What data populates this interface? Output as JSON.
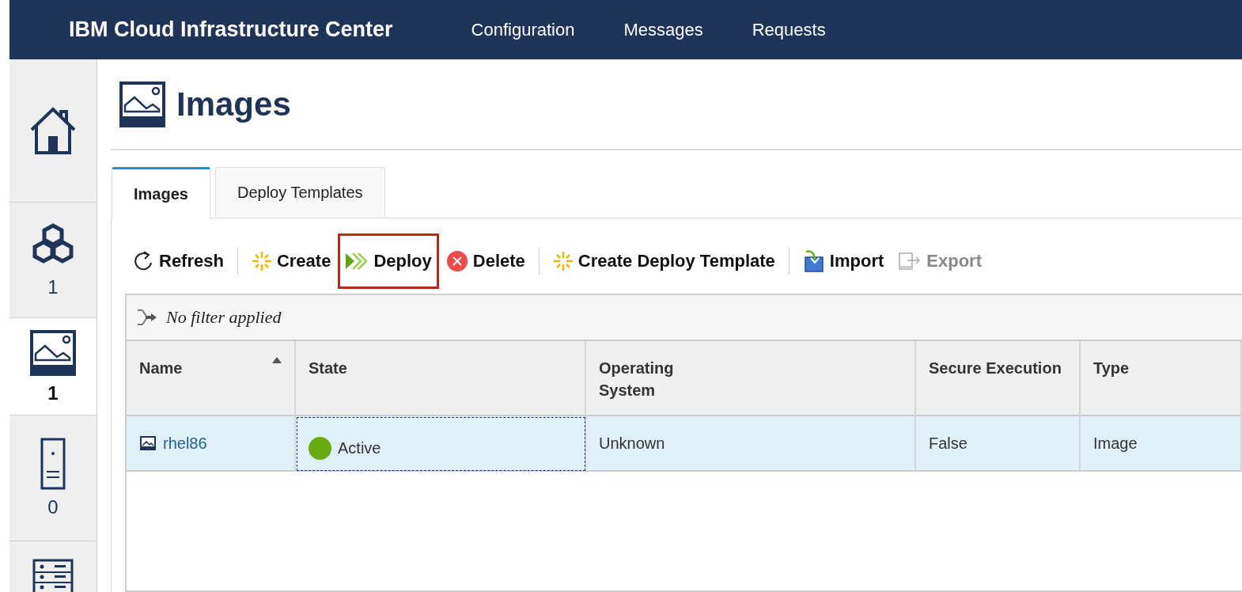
{
  "topbar": {
    "title": "IBM Cloud Infrastructure Center",
    "nav": [
      {
        "label": "Configuration"
      },
      {
        "label": "Messages"
      },
      {
        "label": "Requests"
      }
    ]
  },
  "sidebar": {
    "items": [
      {
        "kind": "home",
        "selected": false
      },
      {
        "kind": "clusters",
        "count": "1",
        "selected": false
      },
      {
        "kind": "images",
        "count": "1",
        "selected": true
      },
      {
        "kind": "hosts",
        "count": "0",
        "selected": false
      },
      {
        "kind": "storage",
        "selected": false
      }
    ]
  },
  "page": {
    "title": "Images"
  },
  "tabs": [
    {
      "label": "Images",
      "selected": true
    },
    {
      "label": "Deploy Templates",
      "selected": false
    }
  ],
  "toolbar": [
    {
      "kind": "refresh",
      "label": "Refresh",
      "disabled": false,
      "highlighted": false
    },
    {
      "kind": "separator"
    },
    {
      "kind": "create",
      "label": "Create",
      "disabled": false,
      "highlighted": false
    },
    {
      "kind": "deploy",
      "label": "Deploy",
      "disabled": false,
      "highlighted": true
    },
    {
      "kind": "delete",
      "label": "Delete",
      "disabled": false,
      "highlighted": false
    },
    {
      "kind": "separator"
    },
    {
      "kind": "create",
      "label": "Create Deploy Template",
      "disabled": false,
      "highlighted": false
    },
    {
      "kind": "separator"
    },
    {
      "kind": "import",
      "label": "Import",
      "disabled": false,
      "highlighted": false
    },
    {
      "kind": "export",
      "label": "Export",
      "disabled": true,
      "highlighted": false
    }
  ],
  "filter": {
    "text": "No filter applied"
  },
  "table": {
    "columns": [
      {
        "label": "Name",
        "sort_ascending": true
      },
      {
        "label": "State",
        "sort_ascending": false
      },
      {
        "label": "Operating System",
        "sort_ascending": false
      },
      {
        "label": "Secure Execution",
        "sort_ascending": false
      },
      {
        "label": "Type",
        "sort_ascending": false
      }
    ],
    "rows": [
      {
        "selected": true,
        "name": "rhel86",
        "state": "Active",
        "color": "#6aaa12",
        "os": "Unknown",
        "secure_execution": "False",
        "type": "Image"
      }
    ]
  }
}
